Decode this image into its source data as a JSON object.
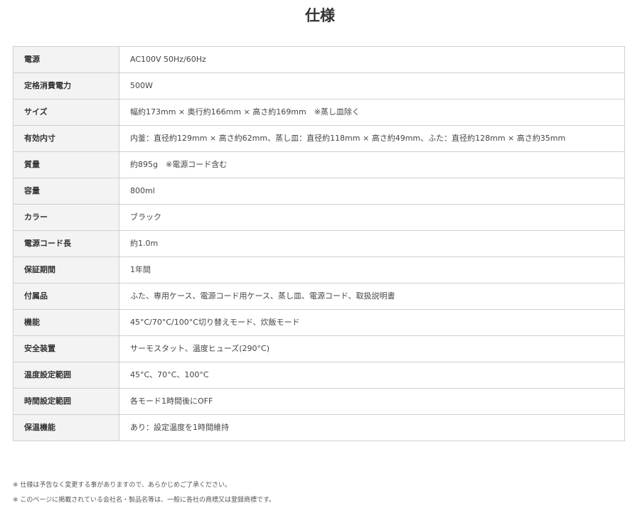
{
  "page": {
    "title": "仕様"
  },
  "specs": [
    {
      "label": "電源",
      "value": "AC100V 50Hz/60Hz"
    },
    {
      "label": "定格消費電力",
      "value": "500W"
    },
    {
      "label": "サイズ",
      "value": "幅約173mm × 奥行約166mm × 高さ約169mm　※蒸し皿除く"
    },
    {
      "label": "有効内寸",
      "value": "内釜：直径約129mm × 高さ約62mm、蒸し皿：直径約118mm × 高さ約49mm、ふた：直径約128mm × 高さ約35mm"
    },
    {
      "label": "質量",
      "value": "約895g　※電源コード含む"
    },
    {
      "label": "容量",
      "value": "800ml"
    },
    {
      "label": "カラー",
      "value": "ブラック"
    },
    {
      "label": "電源コード長",
      "value": "約1.0m"
    },
    {
      "label": "保証期間",
      "value": "1年間"
    },
    {
      "label": "付属品",
      "value": "ふた、専用ケース、電源コード用ケース、蒸し皿、電源コード、取扱説明書"
    },
    {
      "label": "機能",
      "value": "45°C/70°C/100°C切り替えモード、炊飯モード"
    },
    {
      "label": "安全装置",
      "value": "サーモスタット、温度ヒューズ(290°C)"
    },
    {
      "label": "温度設定範囲",
      "value": "45°C、70°C、100°C"
    },
    {
      "label": "時間設定範囲",
      "value": "各モード1時間後にOFF"
    },
    {
      "label": "保温機能",
      "value": "あり：設定温度を1時間維持"
    }
  ],
  "notes": [
    "※ 仕様は予告なく変更する事がありますので、あらかじめご了承ください。",
    "※ このページに掲載されている会社名・製品名等は、一般に各社の商標又は登録商標です。"
  ]
}
